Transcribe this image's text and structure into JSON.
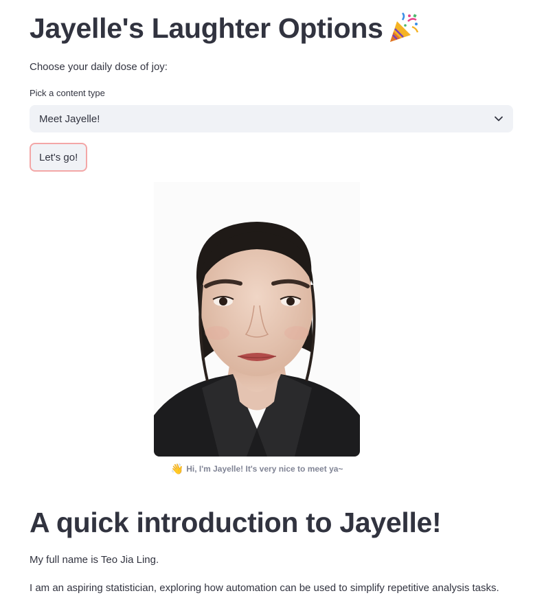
{
  "header": {
    "title": "Jayelle's Laughter Options",
    "title_emoji": "party-popper-icon",
    "subtitle": "Choose your daily dose of joy:"
  },
  "content_select": {
    "label": "Pick a content type",
    "value": "Meet Jayelle!"
  },
  "go_button": {
    "label": "Let's go!"
  },
  "profile": {
    "image": "portrait-photo",
    "caption_emoji": "👋",
    "caption": "Hi, I'm Jayelle! It's very nice to meet ya~"
  },
  "intro": {
    "heading": "A quick introduction to Jayelle!",
    "paragraphs": [
      "My full name is Teo Jia Ling.",
      "I am an aspiring statistician, exploring how automation can be used to simplify repetitive analysis tasks."
    ]
  },
  "colors": {
    "text": "#31333f",
    "widget_bg": "#f0f2f6",
    "button_border": "#f3a6a6",
    "caption": "#808495"
  }
}
